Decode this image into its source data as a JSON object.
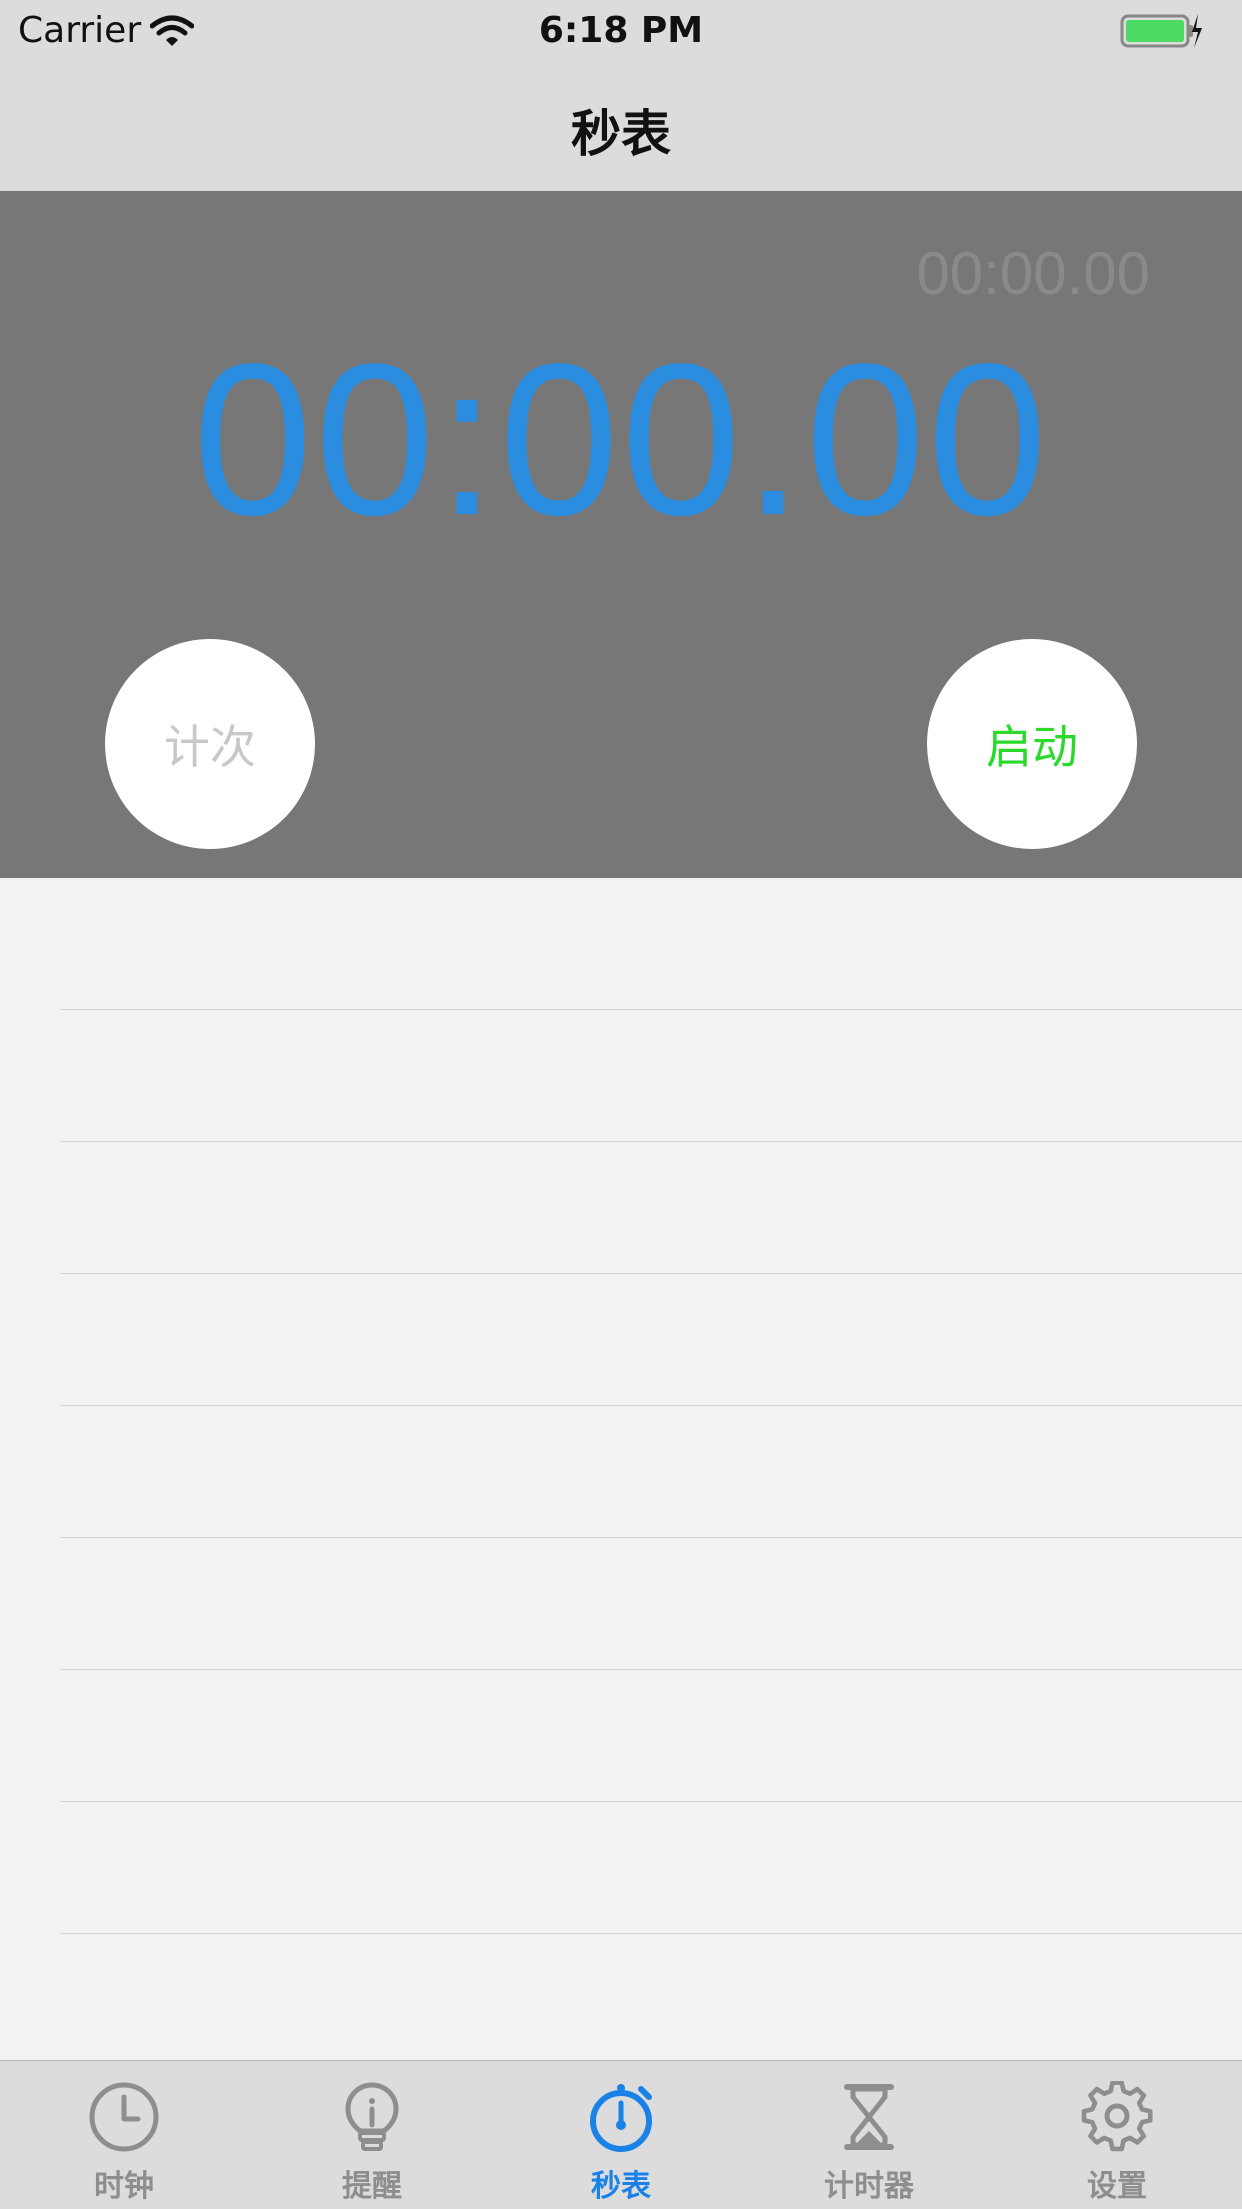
{
  "status": {
    "carrier": "Carrier",
    "time": "6:18 PM"
  },
  "nav": {
    "title": "秒表"
  },
  "stopwatch": {
    "lap_time": "00:00.00",
    "main_time": "00:00.00",
    "lap_button": "计次",
    "start_button": "启动"
  },
  "tabs": [
    {
      "label": "时钟",
      "icon": "clock-icon",
      "active": false
    },
    {
      "label": "提醒",
      "icon": "lightbulb-icon",
      "active": false
    },
    {
      "label": "秒表",
      "icon": "stopwatch-icon",
      "active": true
    },
    {
      "label": "计时器",
      "icon": "hourglass-icon",
      "active": false
    },
    {
      "label": "设置",
      "icon": "gear-icon",
      "active": false
    }
  ],
  "colors": {
    "accent": "#1a82e6",
    "time_digits": "#2b8de0",
    "start_green": "#2bd92b",
    "panel_gray": "#777777"
  }
}
